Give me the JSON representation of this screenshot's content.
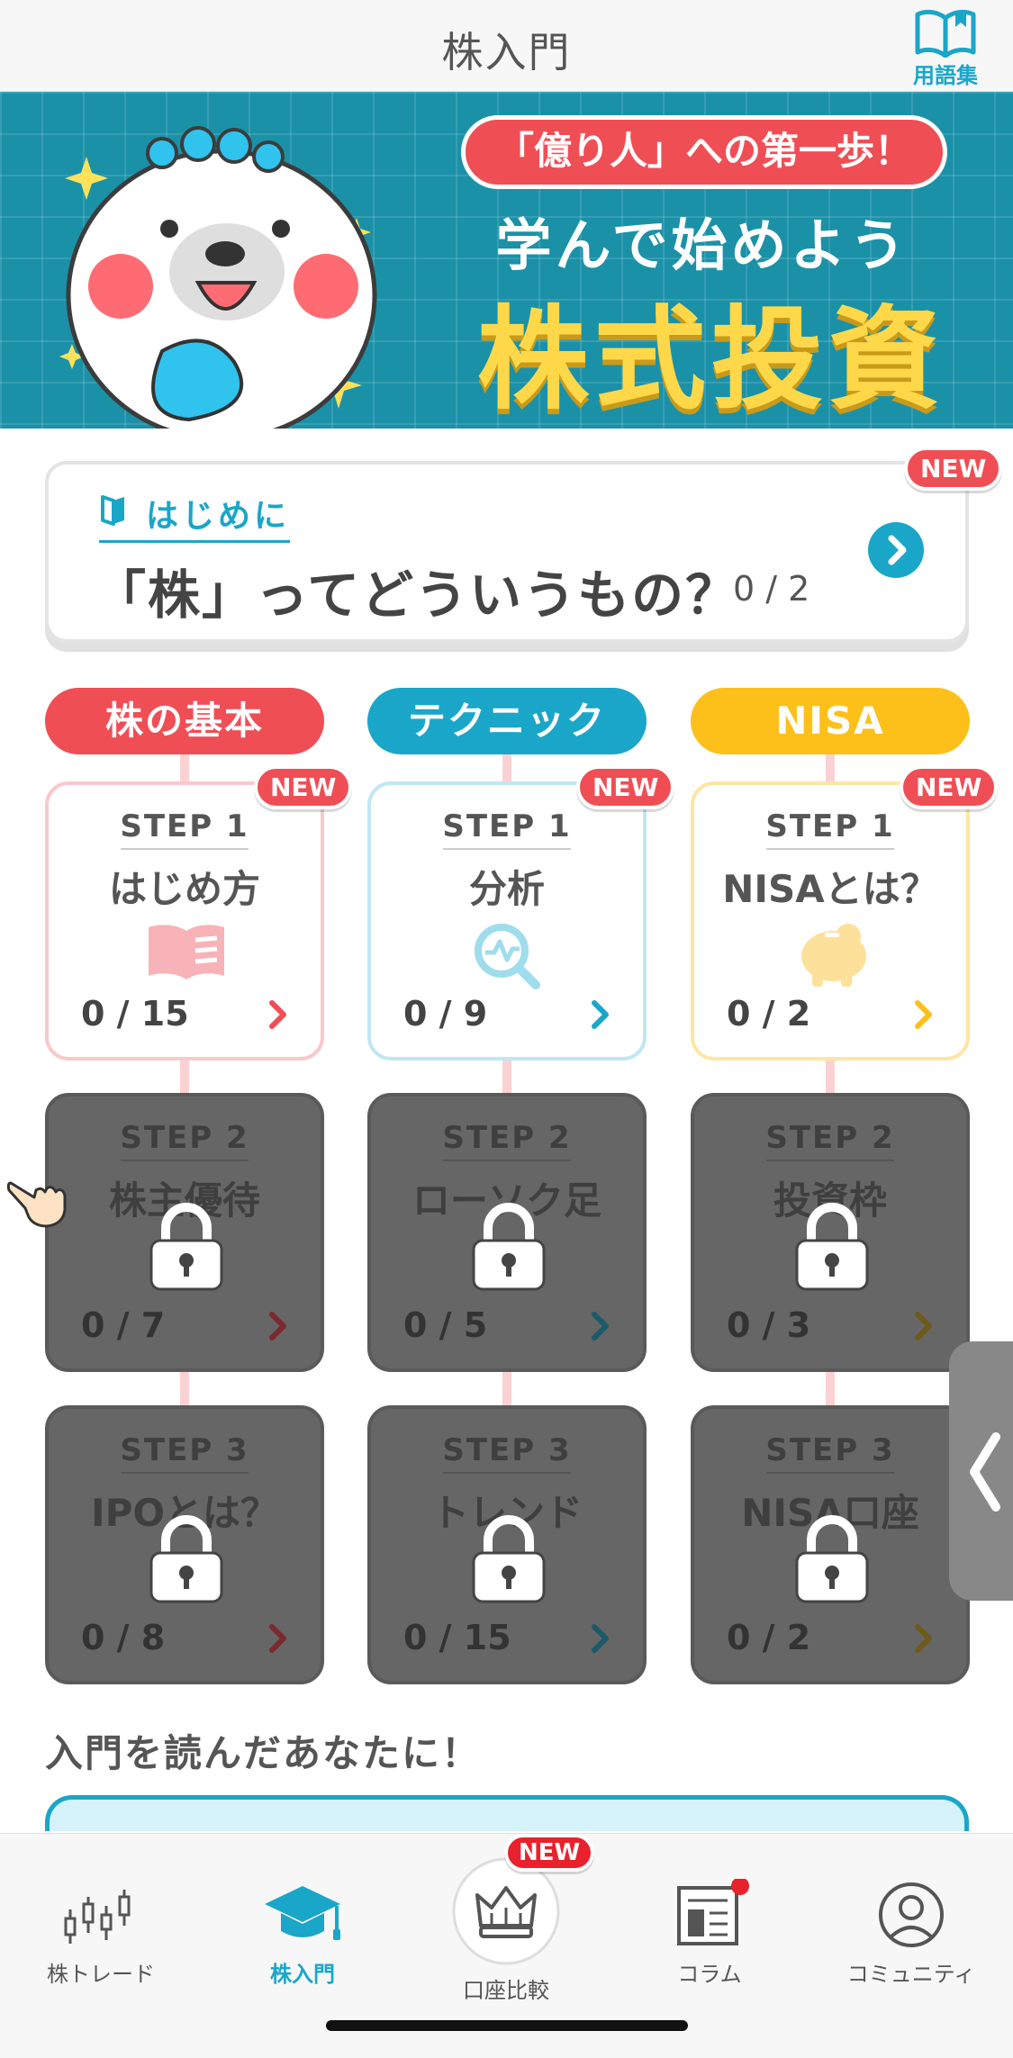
{
  "header": {
    "title": "株入門",
    "glossary_label": "用語集"
  },
  "banner": {
    "pill": "「億り人」への第一歩！",
    "subtitle": "学んで始めよう",
    "main": "株式投資"
  },
  "intro": {
    "tag": "はじめに",
    "headline": "「株」ってどういうもの？",
    "progress": "0 / 2",
    "badge": "NEW"
  },
  "categories": [
    {
      "label": "株の基本",
      "color": "#f04e55"
    },
    {
      "label": "テクニック",
      "color": "#1aa6c9"
    },
    {
      "label": "NISA",
      "color": "#fdbf1a"
    }
  ],
  "steps": {
    "basic": [
      {
        "step": "STEP 1",
        "name": "はじめ方",
        "progress": "0 / 15",
        "badge": "NEW"
      },
      {
        "step": "STEP 2",
        "name": "株主優待",
        "progress": "0 / 7"
      },
      {
        "step": "STEP 3",
        "name": "IPOとは？",
        "progress": "0 / 8"
      }
    ],
    "technique": [
      {
        "step": "STEP 1",
        "name": "分析",
        "progress": "0 / 9",
        "badge": "NEW"
      },
      {
        "step": "STEP 2",
        "name": "ローソク足",
        "progress": "0 / 5"
      },
      {
        "step": "STEP 3",
        "name": "トレンド",
        "progress": "0 / 15"
      }
    ],
    "nisa": [
      {
        "step": "STEP 1",
        "name": "NISAとは？",
        "progress": "0 / 2",
        "badge": "NEW"
      },
      {
        "step": "STEP 2",
        "name": "投資枠",
        "progress": "0 / 3"
      },
      {
        "step": "STEP 3",
        "name": "NISA口座",
        "progress": "0 / 2"
      }
    ]
  },
  "recommend": {
    "title": "入門を読んだあなたに！"
  },
  "nav": [
    {
      "label": "株トレード",
      "icon": "candlestick-icon"
    },
    {
      "label": "株入門",
      "icon": "graduation-cap-icon",
      "active": true
    },
    {
      "label": "口座比較",
      "icon": "crown-icon",
      "badge": "NEW"
    },
    {
      "label": "コラム",
      "icon": "column-icon"
    },
    {
      "label": "コミュニティ",
      "icon": "community-icon"
    }
  ]
}
